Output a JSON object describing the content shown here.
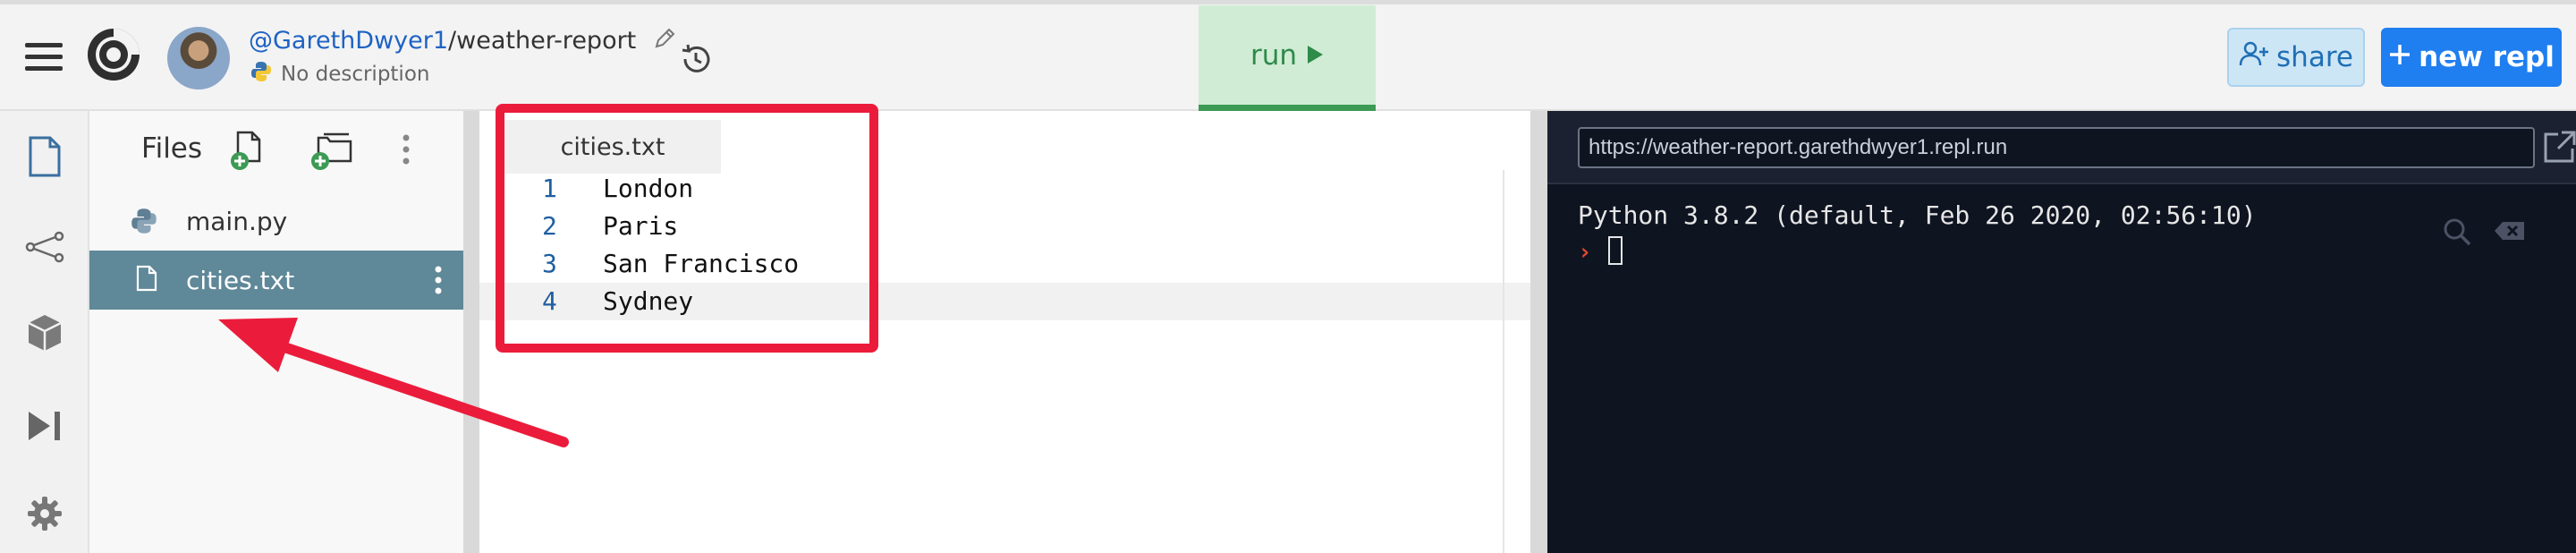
{
  "header": {
    "owner": "@GarethDwyer1",
    "separator": "/",
    "repl_name": "weather-report",
    "description": "No description",
    "run_label": "run",
    "share_label": "share",
    "new_repl_label": "new repl"
  },
  "files_panel": {
    "title": "Files",
    "files": [
      {
        "name": "main.py",
        "type": "python"
      },
      {
        "name": "cities.txt",
        "type": "text",
        "active": true
      }
    ]
  },
  "editor": {
    "tab": "cities.txt",
    "lines": [
      {
        "number": "1",
        "text": "London"
      },
      {
        "number": "2",
        "text": "Paris"
      },
      {
        "number": "3",
        "text": "San Francisco"
      },
      {
        "number": "4",
        "text": "Sydney"
      }
    ]
  },
  "console": {
    "url": "https://weather-report.garethdwyer1.repl.run",
    "banner": "Python 3.8.2 (default, Feb 26 2020, 02:56:10)",
    "prompt": "›"
  },
  "colors": {
    "annotation": "#eb1c3b",
    "accent": "#1f7ef0",
    "run_green": "#3c9a55",
    "active_file": "#5f8898"
  },
  "icons": [
    "menu-icon",
    "replit-logo",
    "pencil-icon",
    "history-icon",
    "play-icon",
    "add-user-icon",
    "plus-icon",
    "file-icon",
    "share-nodes-icon",
    "package-icon",
    "debugger-icon",
    "settings-icon",
    "new-file-icon",
    "new-folder-icon",
    "more-icon",
    "python-icon",
    "open-external-icon",
    "search-icon",
    "clear-icon"
  ]
}
